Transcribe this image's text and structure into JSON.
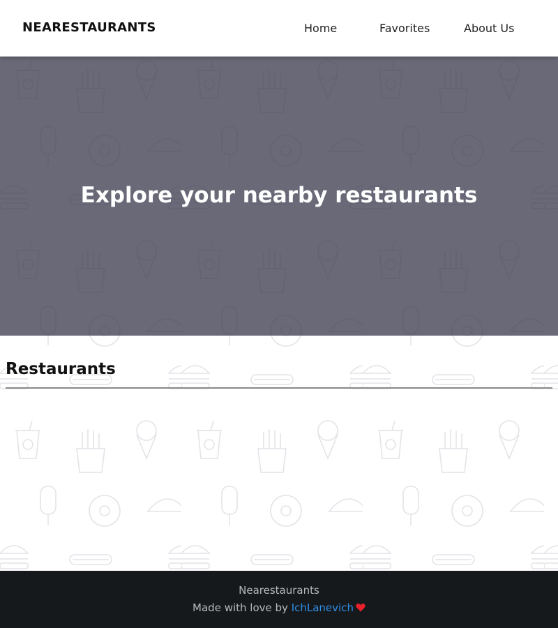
{
  "navbar": {
    "brand": "NEARESTAURANTS",
    "links": [
      "Home",
      "Favorites",
      "About Us"
    ]
  },
  "hero": {
    "title": "Explore your nearby restaurants"
  },
  "main": {
    "section_title": "Restaurants"
  },
  "footer": {
    "brand": "Nearestaurants",
    "credit_prefix": "Made with love by ",
    "author": "IchLanevich",
    "heart_icon": "heart-icon"
  },
  "colors": {
    "hero_overlay": "#5d5d6e",
    "footer_bg": "#16191c",
    "link": "#2f8ee5",
    "heart": "#e8202a"
  }
}
